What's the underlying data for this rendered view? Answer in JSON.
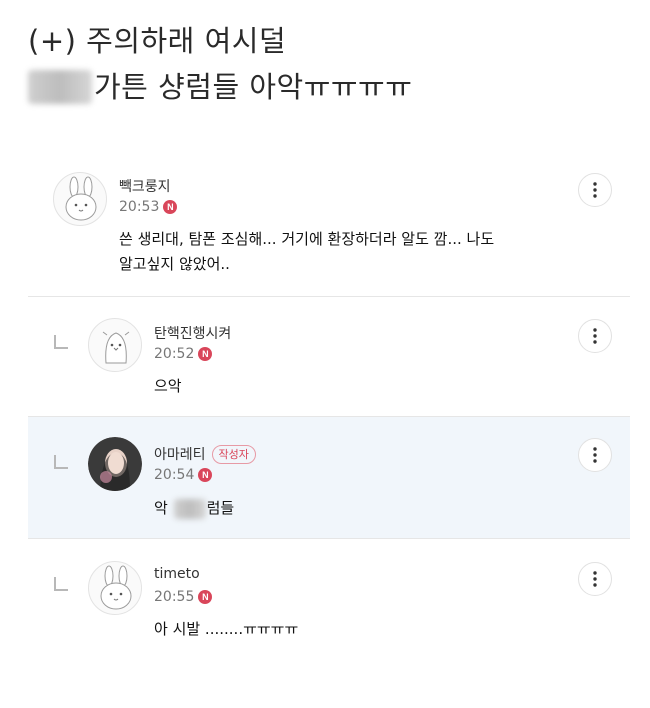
{
  "post": {
    "title_line1": "(+) 주의하래 여시덜",
    "title_line2_suffix": "가튼 샹럼들 아악ㅠㅠㅠㅠ"
  },
  "comments": [
    {
      "nickname": "빽크룽지",
      "time": "20:53",
      "new_badge": "N",
      "text_line1": "쓴 생리대, 탐폰 조심해... 거기에 환장하더라 알도 깜... 나도",
      "text_line2": "알고싶지 않았어..",
      "avatar_icon": "rabbit-avatar-icon",
      "is_reply": false
    },
    {
      "nickname": "탄핵진행시켜",
      "time": "20:52",
      "new_badge": "N",
      "text": "으악",
      "avatar_icon": "penguin-avatar-icon",
      "is_reply": true
    },
    {
      "nickname": "아마레티",
      "author_badge": "작성자",
      "time": "20:54",
      "new_badge": "N",
      "text_prefix": "악",
      "text_suffix": "럼들",
      "avatar_icon": "photo-avatar",
      "is_reply": true,
      "highlighted": true
    },
    {
      "nickname": "timeto",
      "time": "20:55",
      "new_badge": "N",
      "text": "아 시발 ........ㅠㅠㅠㅠ",
      "avatar_icon": "rabbit-avatar-icon",
      "is_reply": true
    }
  ],
  "colors": {
    "new_badge": "#d9465a",
    "author_badge": "#d9465a",
    "highlight_bg": "#f1f6fb"
  }
}
